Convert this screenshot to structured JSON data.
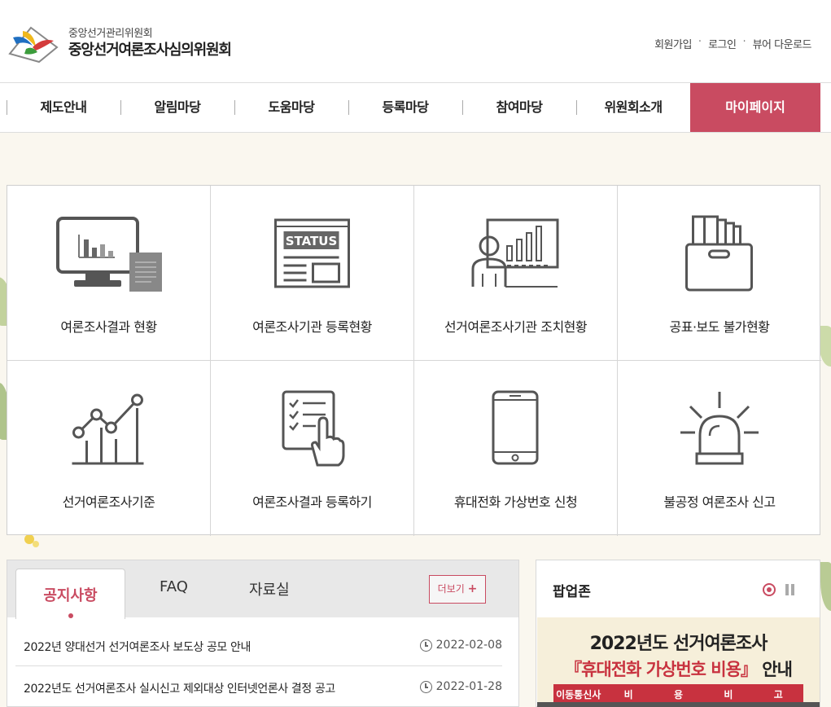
{
  "header": {
    "org_sub": "중앙선거관리위원회",
    "org_main": "중앙선거여론조사심의위원회",
    "util_links": [
      "회원가입",
      "로그인",
      "뷰어 다운로드"
    ],
    "util_sep": "·"
  },
  "nav": {
    "items": [
      "제도안내",
      "알림마당",
      "도움마당",
      "등록마당",
      "참여마당",
      "위원회소개"
    ],
    "mypage": "마이페이지",
    "accent_color": "#c94b61"
  },
  "quick_menu": [
    {
      "label": "여론조사결과 현황",
      "icon": "monitor-chart-icon"
    },
    {
      "label": "여론조사기관 등록현황",
      "icon": "status-board-icon"
    },
    {
      "label": "선거여론조사기관 조치현황",
      "icon": "presenter-chart-icon"
    },
    {
      "label": "공표·보도 불가현황",
      "icon": "document-box-icon"
    },
    {
      "label": "선거여론조사기준",
      "icon": "line-chart-icon"
    },
    {
      "label": "여론조사결과 등록하기",
      "icon": "checklist-touch-icon"
    },
    {
      "label": "휴대전화 가상번호 신청",
      "icon": "mobile-phone-icon"
    },
    {
      "label": "불공정 여론조사 신고",
      "icon": "alarm-siren-icon"
    }
  ],
  "board": {
    "tabs": [
      "공지사항",
      "FAQ",
      "자료실"
    ],
    "more_label": "더보기",
    "more_icon": "+",
    "notices": [
      {
        "title": "2022년 양대선거 선거여론조사 보도상 공모 안내",
        "date": "2022-02-08"
      },
      {
        "title": "2022년도 선거여론조사 실시신고 제외대상 인터넷언론사 결정 공고",
        "date": "2022-01-28"
      }
    ]
  },
  "popup": {
    "title": "팝업존",
    "banner_line1": "2022년도 선거여론조사",
    "banner_line2_red": "『휴대전화 가상번호 비용』",
    "banner_line2_tail": " 안내",
    "banner_table_headers": [
      "이동통신사",
      "비",
      "용",
      "비",
      "고"
    ]
  }
}
